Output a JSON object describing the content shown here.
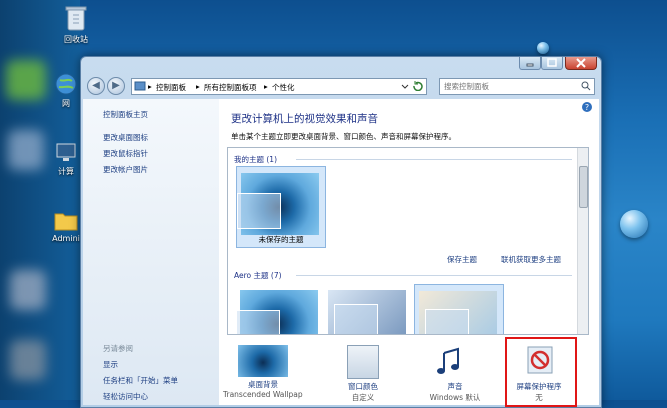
{
  "desktop": {
    "icons": [
      {
        "label": "回收站"
      },
      {
        "label": "网"
      },
      {
        "label": "计算"
      },
      {
        "label": "Admini"
      }
    ]
  },
  "window": {
    "breadcrumb": {
      "root": "控制面板",
      "all": "所有控制面板项",
      "current": "个性化",
      "sep": "▸"
    },
    "search_placeholder": "搜索控制面板",
    "nav": {
      "back": "◀",
      "forward": "▶"
    },
    "left_nav": {
      "home": "控制面板主页",
      "links": [
        "更改桌面图标",
        "更改鼠标指针",
        "更改帐户图片"
      ],
      "see_also_title": "另请参阅",
      "see_also": [
        "显示",
        "任务栏和「开始」菜单",
        "轻松访问中心"
      ]
    },
    "main": {
      "heading": "更改计算机上的视觉效果和声音",
      "subtitle": "单击某个主题立即更改桌面背景、窗口颜色、声音和屏幕保护程序。",
      "my_themes_label": "我的主题 (1)",
      "unsaved_theme": "未保存的主题",
      "save_theme": "保存主题",
      "get_more": "联机获取更多主题",
      "aero_label": "Aero 主题 (7)",
      "bottom": [
        {
          "label": "桌面背景",
          "sub": "Transcended Wallpaper"
        },
        {
          "label": "窗口颜色",
          "sub": "自定义"
        },
        {
          "label": "声音",
          "sub": "Windows 默认"
        },
        {
          "label": "屏幕保护程序",
          "sub": "无"
        }
      ]
    }
  }
}
